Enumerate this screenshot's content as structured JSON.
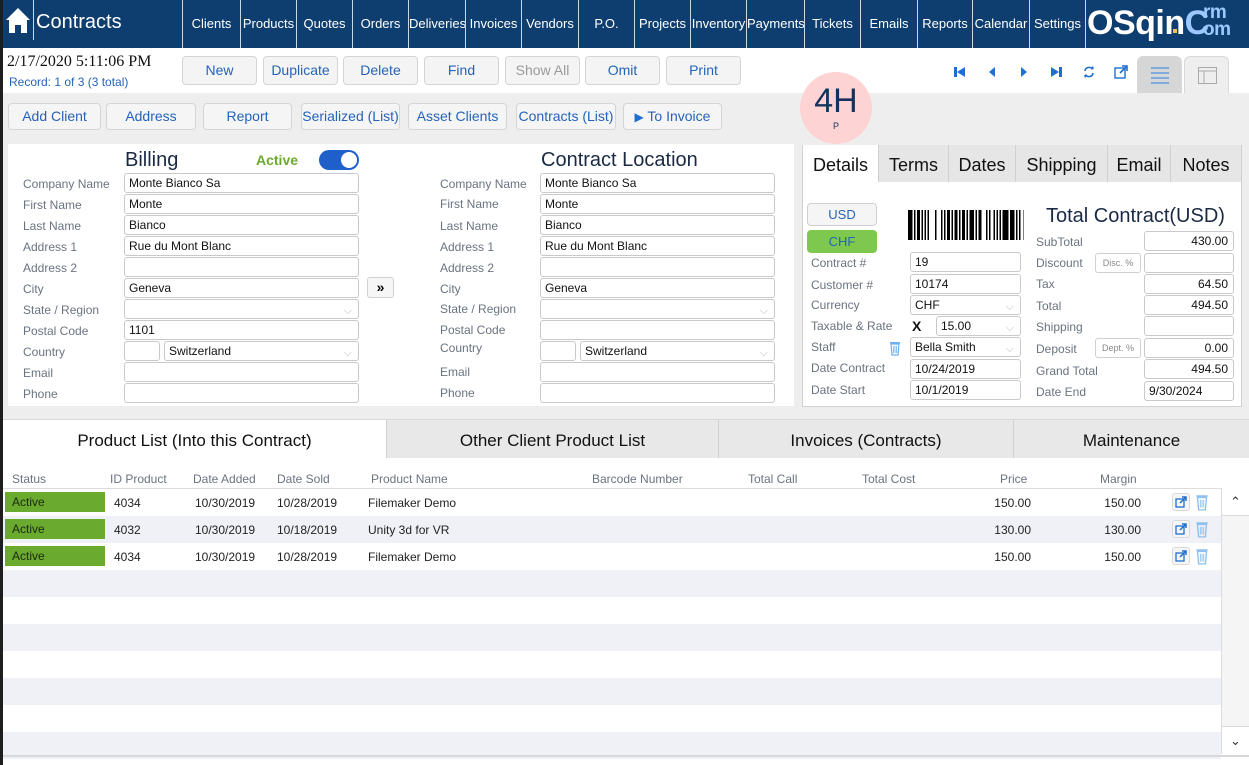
{
  "app": {
    "title": "Contracts"
  },
  "nav": [
    "Clients",
    "Products",
    "Quotes",
    "Orders",
    "Deliveries",
    "Invoices",
    "Vendors",
    "P.O.",
    "Projects",
    "Inventory",
    "Payments",
    "Tickets",
    "Emails",
    "Reports",
    "Calendar",
    "Settings"
  ],
  "logo": {
    "main": "OSqin",
    "c": "C",
    "sup": "rm",
    "sub": "om"
  },
  "header": {
    "datetime": "2/17/2020 5:11:06 PM",
    "record": "Record:  1 of 3 (3 total)"
  },
  "toolbar": {
    "new": "New",
    "duplicate": "Duplicate",
    "delete": "Delete",
    "find": "Find",
    "show_all": "Show All",
    "omit": "Omit",
    "print": "Print"
  },
  "actions": {
    "add_client": "Add Client",
    "address": "Address",
    "report": "Report",
    "serialized": "Serialized (List)",
    "asset_clients": "Asset Clients",
    "contracts_list": "Contracts (List)",
    "to_invoice": "To Invoice"
  },
  "badge": {
    "big": "4H",
    "small": "P"
  },
  "billing": {
    "title": "Billing",
    "active_label": "Active",
    "active": true,
    "labels": {
      "company": "Company Name",
      "first": "First Name",
      "last": "Last Name",
      "addr1": "Address 1",
      "addr2": "Address 2",
      "city": "City",
      "state": "State / Region",
      "postal": "Postal Code",
      "country": "Country",
      "email": "Email",
      "phone": "Phone"
    },
    "values": {
      "company": "Monte Bianco Sa",
      "first": "Monte",
      "last": "Bianco",
      "addr1": "Rue du Mont Blanc",
      "addr2": "",
      "city": "Geneva",
      "state": "",
      "postal": "1101",
      "country_code": "",
      "country": "Switzerland",
      "email": "",
      "phone": ""
    }
  },
  "location": {
    "title": "Contract Location",
    "values": {
      "company": "Monte Bianco Sa",
      "first": "Monte",
      "last": "Bianco",
      "addr1": "Rue du Mont Blanc",
      "addr2": "",
      "city": "Geneva",
      "state": "",
      "postal": "",
      "country_code": "",
      "country": "Switzerland",
      "email": "",
      "phone": ""
    }
  },
  "details": {
    "tabs": [
      "Details",
      "Terms",
      "Dates",
      "Shipping",
      "Email",
      "Notes"
    ],
    "currency_buttons": [
      "USD",
      "CHF"
    ],
    "labels": {
      "contract_no": "Contract #",
      "customer_no": "Customer #",
      "currency": "Currency",
      "taxable": "Taxable & Rate",
      "staff": "Staff",
      "date_contract": "Date Contract",
      "date_start": "Date Start"
    },
    "values": {
      "contract_no": "19",
      "customer_no": "10174",
      "currency": "CHF",
      "taxable_mark": "X",
      "tax_rate": "15.00",
      "staff": "Bella Smith",
      "date_contract": "10/24/2019",
      "date_start": "10/1/2019"
    },
    "total_title": "Total Contract(USD)",
    "totals_labels": {
      "subtotal": "SubTotal",
      "discount": "Discount",
      "tax": "Tax",
      "total": "Total",
      "shipping": "Shipping",
      "deposit": "Deposit",
      "grand_total": "Grand Total",
      "date_end": "Date End"
    },
    "totals": {
      "subtotal": "430.00",
      "discount": "",
      "tax": "64.50",
      "total": "494.50",
      "shipping": "",
      "deposit": "0.00",
      "grand_total": "494.50",
      "date_end": "9/30/2024"
    },
    "disc_btn": "Disc. %",
    "dept_btn": "Dept. %"
  },
  "bottom_tabs": [
    "Product List (Into this Contract)",
    "Other Client Product List",
    "Invoices (Contracts)",
    "Maintenance"
  ],
  "products": {
    "columns": [
      "Status",
      "ID Product",
      "Date Added",
      "Date Sold",
      "Product Name",
      "Barcode Number",
      "Total Call",
      "Total Cost",
      "Price",
      "Margin"
    ],
    "rows": [
      {
        "status": "Active",
        "id": "4034",
        "date_added": "10/30/2019",
        "date_sold": "10/28/2019",
        "name": "Filemaker Demo",
        "barcode": "",
        "total_call": "",
        "total_cost": "",
        "price": "150.00",
        "margin": "150.00"
      },
      {
        "status": "Active",
        "id": "4032",
        "date_added": "10/30/2019",
        "date_sold": "10/18/2019",
        "name": "Unity 3d for VR",
        "barcode": "",
        "total_call": "",
        "total_cost": "",
        "price": "130.00",
        "margin": "130.00"
      },
      {
        "status": "Active",
        "id": "4034",
        "date_added": "10/30/2019",
        "date_sold": "10/28/2019",
        "name": "Filemaker Demo",
        "barcode": "",
        "total_call": "",
        "total_cost": "",
        "price": "150.00",
        "margin": "150.00"
      }
    ]
  },
  "colors": {
    "nav_bg": "#0e3e70",
    "accent": "#2563b8",
    "active_green": "#6aaa2e",
    "badge_bg": "#fdd3d3"
  }
}
